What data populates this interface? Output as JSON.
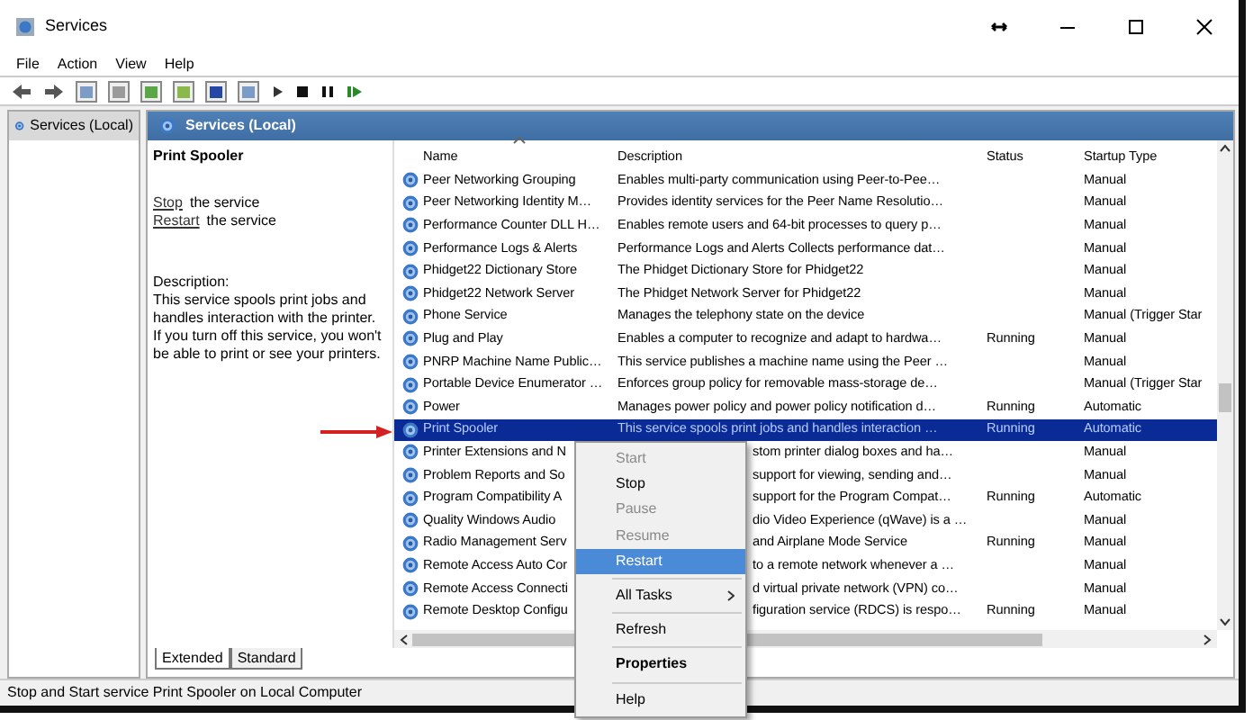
{
  "window": {
    "title": "Services"
  },
  "menu": [
    "File",
    "Action",
    "View",
    "Help"
  ],
  "tree": [
    {
      "label": "Services (Local)",
      "selected": true
    }
  ],
  "panel_header": "Services (Local)",
  "details": {
    "title": "Print Spooler",
    "actions": [
      {
        "link": "Stop",
        "text": "the service"
      },
      {
        "link": "Restart",
        "text": "the service"
      }
    ],
    "description_label": "Description:",
    "description": "This service spools print jobs and handles interaction with the printer. If you turn off this service, you won't be able to print or see your printers."
  },
  "table": {
    "columns": [
      {
        "label": "Name",
        "sorted": true
      },
      {
        "label": "Description",
        "sorted": false
      },
      {
        "label": "Status",
        "sorted": false
      },
      {
        "label": "Startup Type",
        "sorted": false
      }
    ],
    "rows": [
      {
        "name": "Peer Networking Grouping",
        "description": "Enables multi-party communication using Peer-to-Pee…",
        "status": "",
        "startup_type": "Manual",
        "selected": false
      },
      {
        "name": "Peer Networking Identity M…",
        "description": "Provides identity services for the Peer Name Resolutio…",
        "status": "",
        "startup_type": "Manual",
        "selected": false
      },
      {
        "name": "Performance Counter DLL H…",
        "description": "Enables remote users and 64-bit processes to query p…",
        "status": "",
        "startup_type": "Manual",
        "selected": false
      },
      {
        "name": "Performance Logs & Alerts",
        "description": "Performance Logs and Alerts Collects performance dat…",
        "status": "",
        "startup_type": "Manual",
        "selected": false
      },
      {
        "name": "Phidget22 Dictionary Store",
        "description": "The Phidget Dictionary Store for Phidget22",
        "status": "",
        "startup_type": "Manual",
        "selected": false
      },
      {
        "name": "Phidget22 Network Server",
        "description": "The Phidget Network Server for Phidget22",
        "status": "",
        "startup_type": "Manual",
        "selected": false
      },
      {
        "name": "Phone Service",
        "description": "Manages the telephony state on the device",
        "status": "",
        "startup_type": "Manual (Trigger Star",
        "selected": false
      },
      {
        "name": "Plug and Play",
        "description": "Enables a computer to recognize and adapt to hardwa…",
        "status": "Running",
        "startup_type": "Manual",
        "selected": false
      },
      {
        "name": "PNRP Machine Name Public…",
        "description": "This service publishes a machine name using the Peer …",
        "status": "",
        "startup_type": "Manual",
        "selected": false
      },
      {
        "name": "Portable Device Enumerator …",
        "description": "Enforces group policy for removable mass-storage de…",
        "status": "",
        "startup_type": "Manual (Trigger Star",
        "selected": false
      },
      {
        "name": "Power",
        "description": "Manages power policy and power policy notification d…",
        "status": "Running",
        "startup_type": "Automatic",
        "selected": false
      },
      {
        "name": "Print Spooler",
        "description": "This service spools print jobs and handles interaction …",
        "status": "Running",
        "startup_type": "Automatic",
        "selected": true
      },
      {
        "name": "Printer Extensions and N",
        "description": "stom printer dialog boxes and ha…",
        "status": "",
        "startup_type": "Manual",
        "selected": false
      },
      {
        "name": "Problem Reports and So",
        "description": "support for viewing, sending and…",
        "status": "",
        "startup_type": "Manual",
        "selected": false
      },
      {
        "name": "Program Compatibility A",
        "description": "support for the Program Compat…",
        "status": "Running",
        "startup_type": "Automatic",
        "selected": false
      },
      {
        "name": "Quality Windows Audio",
        "description": "dio Video Experience (qWave) is a …",
        "status": "",
        "startup_type": "Manual",
        "selected": false
      },
      {
        "name": "Radio Management Serv",
        "description": "and Airplane Mode Service",
        "status": "Running",
        "startup_type": "Manual",
        "selected": false
      },
      {
        "name": "Remote Access Auto Cor",
        "description": "to a remote network whenever a …",
        "status": "",
        "startup_type": "Manual",
        "selected": false
      },
      {
        "name": "Remote Access Connecti",
        "description": "d virtual private network (VPN) co…",
        "status": "",
        "startup_type": "Manual",
        "selected": false
      },
      {
        "name": "Remote Desktop Configu",
        "description": "figuration service (RDCS) is respo…",
        "status": "Running",
        "startup_type": "Manual",
        "selected": false
      }
    ]
  },
  "bottom_tabs": [
    {
      "label": "Extended",
      "selected": true
    },
    {
      "label": "Standard",
      "selected": false
    }
  ],
  "context_menu": [
    {
      "kind": "item",
      "label": "Start",
      "disabled": true,
      "selected": false,
      "bold": false,
      "submenu": false
    },
    {
      "kind": "item",
      "label": "Stop",
      "disabled": false,
      "selected": false,
      "bold": false,
      "submenu": false
    },
    {
      "kind": "item",
      "label": "Pause",
      "disabled": true,
      "selected": false,
      "bold": false,
      "submenu": false
    },
    {
      "kind": "item",
      "label": "Resume",
      "disabled": true,
      "selected": false,
      "bold": false,
      "submenu": false
    },
    {
      "kind": "item",
      "label": "Restart",
      "disabled": false,
      "selected": true,
      "bold": false,
      "submenu": false
    },
    {
      "kind": "separator"
    },
    {
      "kind": "item",
      "label": "All Tasks",
      "disabled": false,
      "selected": false,
      "bold": false,
      "submenu": true
    },
    {
      "kind": "separator"
    },
    {
      "kind": "item",
      "label": "Refresh",
      "disabled": false,
      "selected": false,
      "bold": false,
      "submenu": false
    },
    {
      "kind": "separator"
    },
    {
      "kind": "item",
      "label": "Properties",
      "disabled": false,
      "selected": false,
      "bold": true,
      "submenu": false
    },
    {
      "kind": "separator"
    },
    {
      "kind": "item",
      "label": "Help",
      "disabled": false,
      "selected": false,
      "bold": false,
      "submenu": false
    }
  ],
  "status_bar": "Stop and Start service Print Spooler on Local Computer"
}
